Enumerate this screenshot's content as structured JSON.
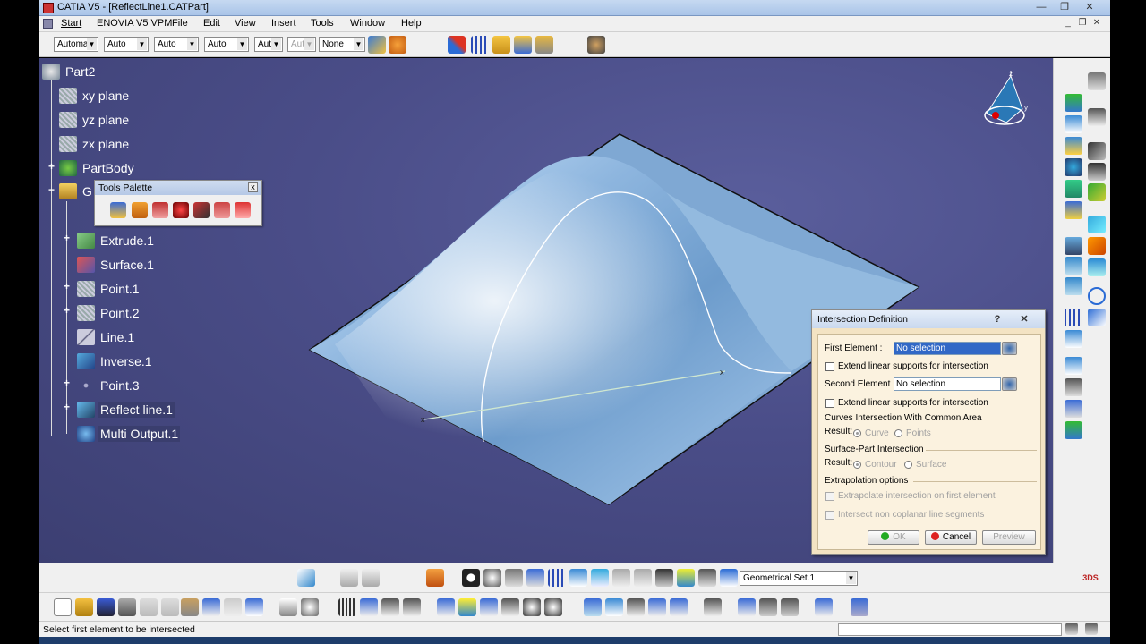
{
  "window": {
    "title": "CATIA V5 - [ReflectLine1.CATPart]",
    "min": "—",
    "max": "❐",
    "close": "✕",
    "doc_min": "_",
    "doc_max": "❐",
    "doc_close": "✕"
  },
  "menu": [
    "Start",
    "ENOVIA V5 VPM",
    "File",
    "Edit",
    "View",
    "Insert",
    "Tools",
    "Window",
    "Help"
  ],
  "toolbar_top": {
    "combos": [
      "Automa",
      "Auto",
      "Auto",
      "Auto",
      "Aut",
      "Aut",
      "None"
    ]
  },
  "tree": {
    "root": "Part2",
    "items": [
      {
        "label": "xy plane"
      },
      {
        "label": "yz plane"
      },
      {
        "label": "zx plane"
      },
      {
        "label": "PartBody"
      },
      {
        "label": "G"
      },
      {
        "label": "Extrude.1"
      },
      {
        "label": "Surface.1"
      },
      {
        "label": "Point.1"
      },
      {
        "label": "Point.2"
      },
      {
        "label": "Line.1"
      },
      {
        "label": "Inverse.1"
      },
      {
        "label": "Point.3"
      },
      {
        "label": "Reflect line.1"
      },
      {
        "label": "Multi Output.1"
      }
    ]
  },
  "tools_palette": {
    "title": "Tools Palette",
    "close": "x"
  },
  "dialog": {
    "title": "Intersection Definition",
    "help": "?",
    "close": "✕",
    "first_element_label": "First Element :",
    "first_element_value": "No selection",
    "extend1": "Extend linear supports for intersection",
    "second_element_label": "Second Element :",
    "second_element_value": "No selection",
    "extend2": "Extend linear supports for intersection",
    "curves_section": "Curves Intersection With Common Area",
    "result_label": "Result:",
    "curve_opt": "Curve",
    "points_opt": "Points",
    "surface_section": "Surface-Part Intersection",
    "result_label2": "Result:",
    "contour_opt": "Contour",
    "surface_opt": "Surface",
    "extrap_section": "Extrapolation options",
    "extrap1": "Extrapolate intersection on first element",
    "extrap2": "Intersect non coplanar line segments",
    "ok": "OK",
    "cancel": "Cancel",
    "preview": "Preview"
  },
  "bottom": {
    "set_combo": "Geometrical Set.1"
  },
  "status": {
    "text": "Select first element to be intersected"
  },
  "colors": {
    "viewport": "#4a4d88",
    "surface": "#8fb7de",
    "dialog_bg": "#f3e3c3"
  }
}
